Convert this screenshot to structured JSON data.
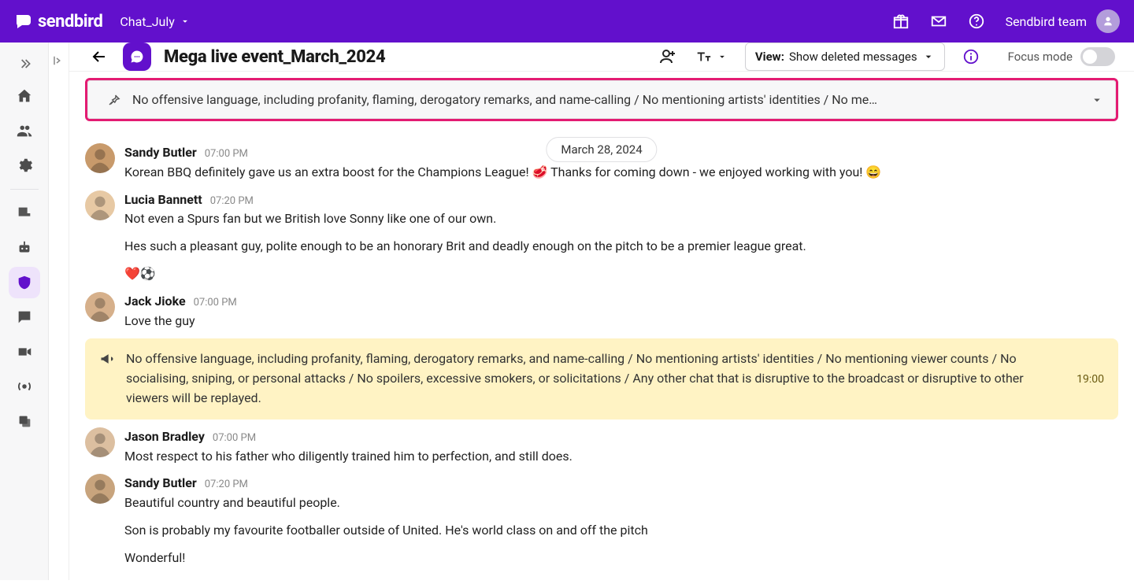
{
  "brand": "sendbird",
  "project": "Chat_July",
  "team_label": "Sendbird team",
  "channel": {
    "title": "Mega live event_March_2024",
    "view_label": "View:",
    "view_value": "Show deleted messages",
    "focus_label": "Focus mode"
  },
  "pinned": {
    "text": "No offensive language, including profanity, flaming, derogatory remarks, and name-calling / No mentioning artists' identities / No me…"
  },
  "date_separator": "March 28, 2024",
  "messages": [
    {
      "name": "Sandy Butler",
      "time": "07:00 PM",
      "paragraphs": [
        "Korean BBQ definitely gave us an extra boost for the Champions League! 🥩 Thanks for coming down - we enjoyed working with you! 😄"
      ]
    },
    {
      "name": "Lucia Bannett",
      "time": "07:20 PM",
      "paragraphs": [
        "Not even a Spurs fan but we British love Sonny like one of our own.",
        "Hes such a pleasant guy, polite enough to be an honorary Brit and deadly enough on the pitch to be a premier league great.",
        "❤️⚽"
      ]
    },
    {
      "name": "Jack Jioke",
      "time": "07:00 PM",
      "paragraphs": [
        "Love the guy"
      ]
    }
  ],
  "announcement": {
    "text": "No offensive language, including profanity, flaming, derogatory remarks, and name-calling / No mentioning artists' identities / No mentioning viewer counts / No socialising, sniping, or personal attacks / No spoilers, excessive smokers, or solicitations / Any other chat that is disruptive to the broadcast or disruptive to other viewers will be replayed.",
    "time": "19:00"
  },
  "messages_after": [
    {
      "name": "Jason Bradley",
      "time": "07:00 PM",
      "paragraphs": [
        "Most respect to his father who diligently trained him to perfection, and still does."
      ]
    },
    {
      "name": "Sandy Butler",
      "time": "07:20 PM",
      "paragraphs": [
        "Beautiful country and beautiful people.",
        "Son is probably my favourite footballer outside of United. He's world class on and off the pitch",
        "Wonderful!"
      ]
    }
  ],
  "avatar_bg": [
    "#c89a6b",
    "#e7c9a4",
    "#d6b08b",
    "#dcbfa0",
    "#c8a47d"
  ]
}
